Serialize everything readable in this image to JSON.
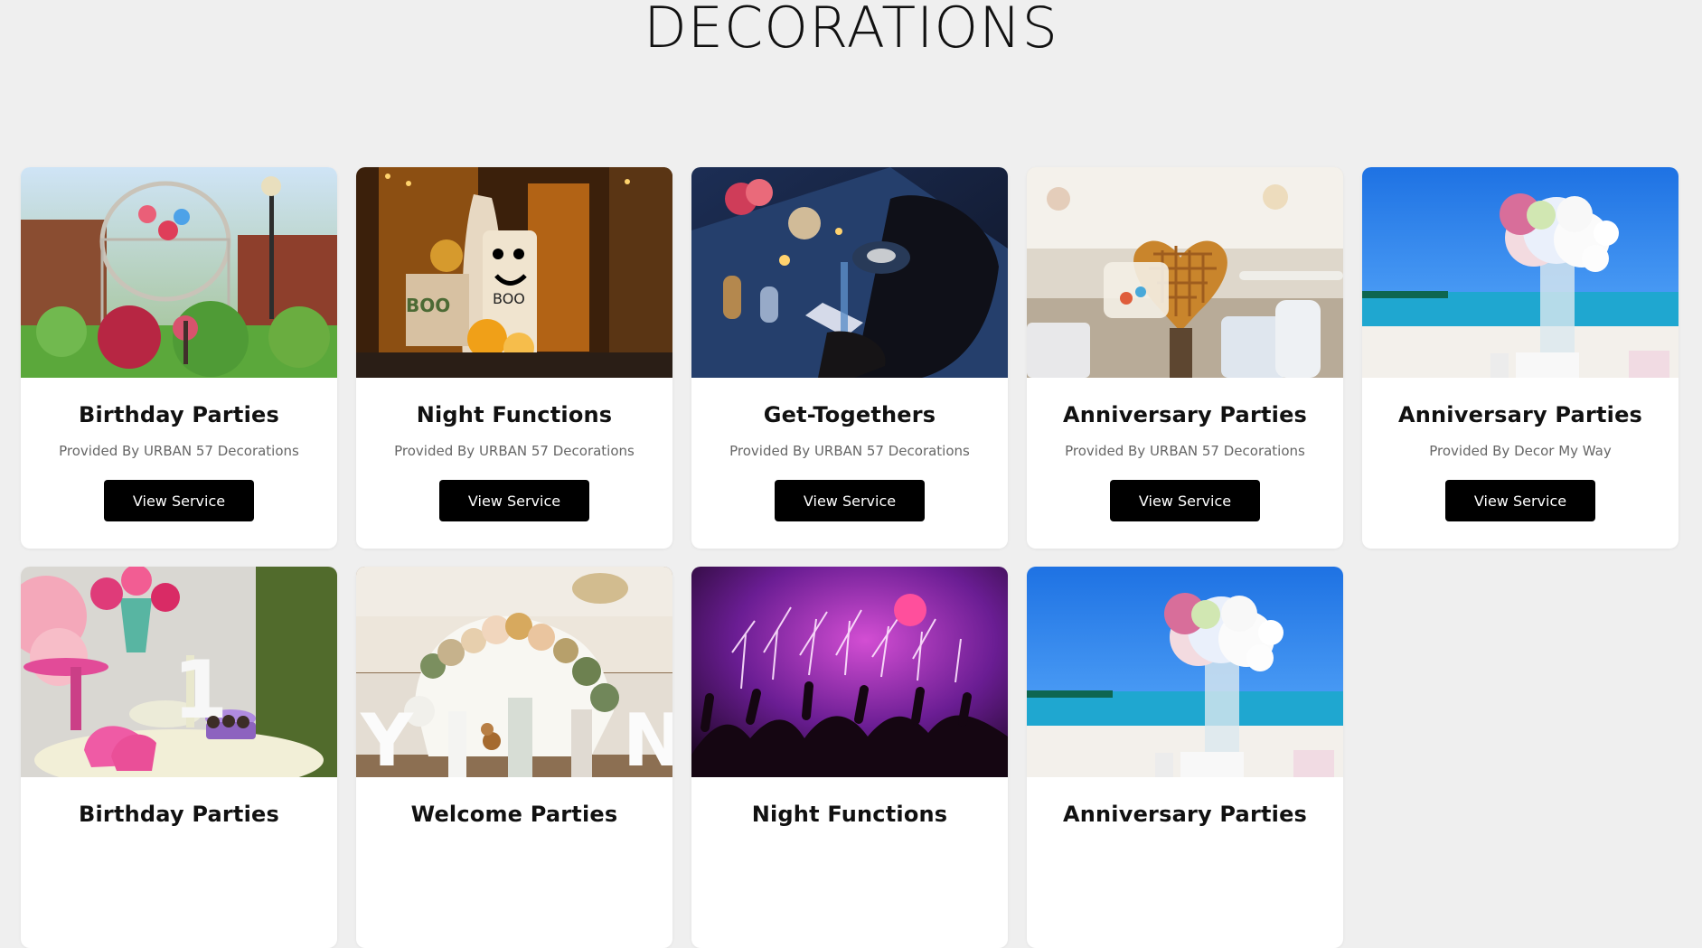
{
  "page": {
    "title": "DECORATIONS"
  },
  "cards": [
    {
      "title": "Birthday Parties",
      "provider": "Provided By URBAN 57 Decorations",
      "button": "View Service",
      "image": "garden-party-photo"
    },
    {
      "title": "Night Functions",
      "provider": "Provided By URBAN 57 Decorations",
      "button": "View Service",
      "image": "halloween-porch-photo"
    },
    {
      "title": "Get-Togethers",
      "provider": "Provided By URBAN 57 Decorations",
      "button": "View Service",
      "image": "night-dinner-table-photo"
    },
    {
      "title": "Anniversary Parties",
      "provider": "Provided By URBAN 57 Decorations",
      "button": "View Service",
      "image": "heart-waffle-photo"
    },
    {
      "title": "Anniversary Parties",
      "provider": "Provided By Decor My Way",
      "button": "View Service",
      "image": "beach-flowers-photo"
    },
    {
      "title": "Birthday Parties",
      "provider": "",
      "button": "",
      "image": "pink-birthday-table-photo"
    },
    {
      "title": "Welcome Parties",
      "provider": "",
      "button": "",
      "image": "balloon-arch-photo"
    },
    {
      "title": "Night Functions",
      "provider": "",
      "button": "",
      "image": "concert-fireworks-photo"
    },
    {
      "title": "Anniversary Parties",
      "provider": "",
      "button": "",
      "image": "beach-flowers-photo"
    }
  ],
  "colors": {
    "background": "#efefef",
    "card": "#ffffff",
    "button": "#000000"
  }
}
